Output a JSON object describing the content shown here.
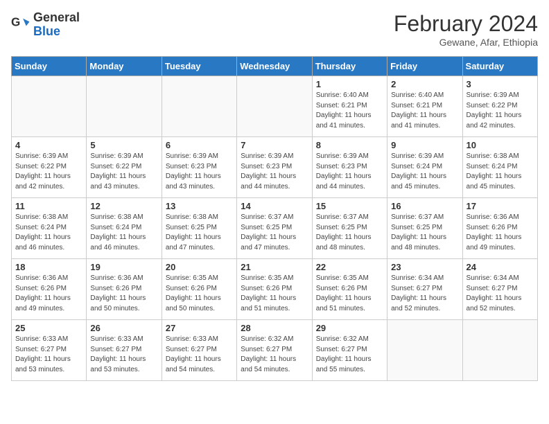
{
  "header": {
    "logo_general": "General",
    "logo_blue": "Blue",
    "month_year": "February 2024",
    "location": "Gewane, Afar, Ethiopia"
  },
  "days_of_week": [
    "Sunday",
    "Monday",
    "Tuesday",
    "Wednesday",
    "Thursday",
    "Friday",
    "Saturday"
  ],
  "weeks": [
    [
      {
        "day": "",
        "info": ""
      },
      {
        "day": "",
        "info": ""
      },
      {
        "day": "",
        "info": ""
      },
      {
        "day": "",
        "info": ""
      },
      {
        "day": "1",
        "info": "Sunrise: 6:40 AM\nSunset: 6:21 PM\nDaylight: 11 hours\nand 41 minutes."
      },
      {
        "day": "2",
        "info": "Sunrise: 6:40 AM\nSunset: 6:21 PM\nDaylight: 11 hours\nand 41 minutes."
      },
      {
        "day": "3",
        "info": "Sunrise: 6:39 AM\nSunset: 6:22 PM\nDaylight: 11 hours\nand 42 minutes."
      }
    ],
    [
      {
        "day": "4",
        "info": "Sunrise: 6:39 AM\nSunset: 6:22 PM\nDaylight: 11 hours\nand 42 minutes."
      },
      {
        "day": "5",
        "info": "Sunrise: 6:39 AM\nSunset: 6:22 PM\nDaylight: 11 hours\nand 43 minutes."
      },
      {
        "day": "6",
        "info": "Sunrise: 6:39 AM\nSunset: 6:23 PM\nDaylight: 11 hours\nand 43 minutes."
      },
      {
        "day": "7",
        "info": "Sunrise: 6:39 AM\nSunset: 6:23 PM\nDaylight: 11 hours\nand 44 minutes."
      },
      {
        "day": "8",
        "info": "Sunrise: 6:39 AM\nSunset: 6:23 PM\nDaylight: 11 hours\nand 44 minutes."
      },
      {
        "day": "9",
        "info": "Sunrise: 6:39 AM\nSunset: 6:24 PM\nDaylight: 11 hours\nand 45 minutes."
      },
      {
        "day": "10",
        "info": "Sunrise: 6:38 AM\nSunset: 6:24 PM\nDaylight: 11 hours\nand 45 minutes."
      }
    ],
    [
      {
        "day": "11",
        "info": "Sunrise: 6:38 AM\nSunset: 6:24 PM\nDaylight: 11 hours\nand 46 minutes."
      },
      {
        "day": "12",
        "info": "Sunrise: 6:38 AM\nSunset: 6:24 PM\nDaylight: 11 hours\nand 46 minutes."
      },
      {
        "day": "13",
        "info": "Sunrise: 6:38 AM\nSunset: 6:25 PM\nDaylight: 11 hours\nand 47 minutes."
      },
      {
        "day": "14",
        "info": "Sunrise: 6:37 AM\nSunset: 6:25 PM\nDaylight: 11 hours\nand 47 minutes."
      },
      {
        "day": "15",
        "info": "Sunrise: 6:37 AM\nSunset: 6:25 PM\nDaylight: 11 hours\nand 48 minutes."
      },
      {
        "day": "16",
        "info": "Sunrise: 6:37 AM\nSunset: 6:25 PM\nDaylight: 11 hours\nand 48 minutes."
      },
      {
        "day": "17",
        "info": "Sunrise: 6:36 AM\nSunset: 6:26 PM\nDaylight: 11 hours\nand 49 minutes."
      }
    ],
    [
      {
        "day": "18",
        "info": "Sunrise: 6:36 AM\nSunset: 6:26 PM\nDaylight: 11 hours\nand 49 minutes."
      },
      {
        "day": "19",
        "info": "Sunrise: 6:36 AM\nSunset: 6:26 PM\nDaylight: 11 hours\nand 50 minutes."
      },
      {
        "day": "20",
        "info": "Sunrise: 6:35 AM\nSunset: 6:26 PM\nDaylight: 11 hours\nand 50 minutes."
      },
      {
        "day": "21",
        "info": "Sunrise: 6:35 AM\nSunset: 6:26 PM\nDaylight: 11 hours\nand 51 minutes."
      },
      {
        "day": "22",
        "info": "Sunrise: 6:35 AM\nSunset: 6:26 PM\nDaylight: 11 hours\nand 51 minutes."
      },
      {
        "day": "23",
        "info": "Sunrise: 6:34 AM\nSunset: 6:27 PM\nDaylight: 11 hours\nand 52 minutes."
      },
      {
        "day": "24",
        "info": "Sunrise: 6:34 AM\nSunset: 6:27 PM\nDaylight: 11 hours\nand 52 minutes."
      }
    ],
    [
      {
        "day": "25",
        "info": "Sunrise: 6:33 AM\nSunset: 6:27 PM\nDaylight: 11 hours\nand 53 minutes."
      },
      {
        "day": "26",
        "info": "Sunrise: 6:33 AM\nSunset: 6:27 PM\nDaylight: 11 hours\nand 53 minutes."
      },
      {
        "day": "27",
        "info": "Sunrise: 6:33 AM\nSunset: 6:27 PM\nDaylight: 11 hours\nand 54 minutes."
      },
      {
        "day": "28",
        "info": "Sunrise: 6:32 AM\nSunset: 6:27 PM\nDaylight: 11 hours\nand 54 minutes."
      },
      {
        "day": "29",
        "info": "Sunrise: 6:32 AM\nSunset: 6:27 PM\nDaylight: 11 hours\nand 55 minutes."
      },
      {
        "day": "",
        "info": ""
      },
      {
        "day": "",
        "info": ""
      }
    ]
  ]
}
